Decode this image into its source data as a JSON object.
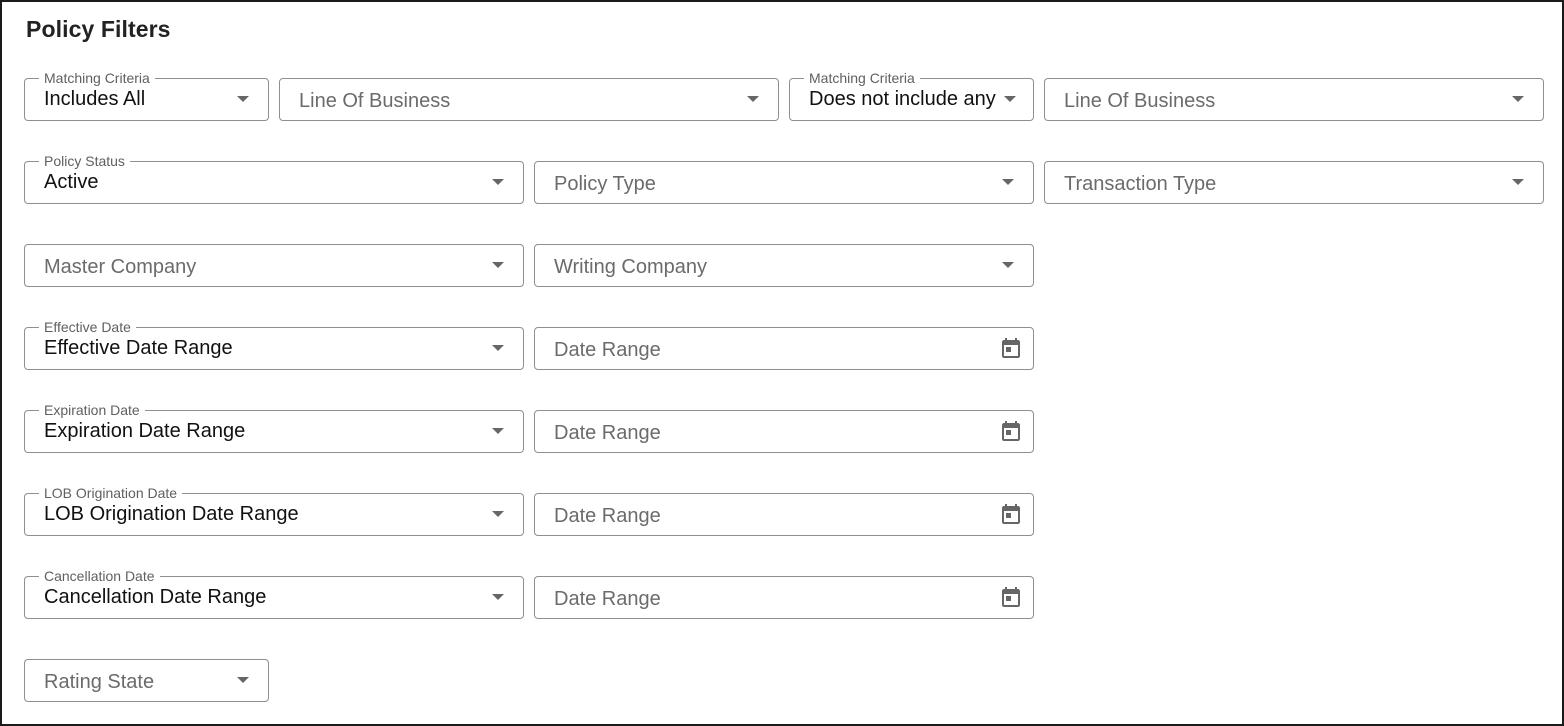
{
  "title": "Policy Filters",
  "row1": {
    "matching_criteria_1": {
      "label": "Matching Criteria",
      "value": "Includes All"
    },
    "line_of_business_1": {
      "placeholder": "Line Of Business"
    },
    "matching_criteria_2": {
      "label": "Matching Criteria",
      "value": "Does not include any"
    },
    "line_of_business_2": {
      "placeholder": "Line Of Business"
    }
  },
  "row2": {
    "policy_status": {
      "label": "Policy Status",
      "value": "Active"
    },
    "policy_type": {
      "placeholder": "Policy Type"
    },
    "transaction_type": {
      "placeholder": "Transaction Type"
    }
  },
  "row3": {
    "master_company": {
      "placeholder": "Master Company"
    },
    "writing_company": {
      "placeholder": "Writing Company"
    }
  },
  "effective": {
    "label": "Effective Date",
    "value": "Effective Date Range",
    "range_placeholder": "Date Range"
  },
  "expiration": {
    "label": "Expiration Date",
    "value": "Expiration Date Range",
    "range_placeholder": "Date Range"
  },
  "lob_origination": {
    "label": "LOB Origination Date",
    "value": "LOB Origination Date Range",
    "range_placeholder": "Date Range"
  },
  "cancellation": {
    "label": "Cancellation Date",
    "value": "Cancellation Date Range",
    "range_placeholder": "Date Range"
  },
  "rating_state": {
    "placeholder": "Rating State"
  },
  "icons": {
    "dropdown": "chevron-down-icon",
    "date": "calendar-icon"
  },
  "colors": {
    "border": "#8f8f8f",
    "label": "#5f5f5f",
    "placeholder": "#6b6b6b",
    "icon": "#666666"
  }
}
